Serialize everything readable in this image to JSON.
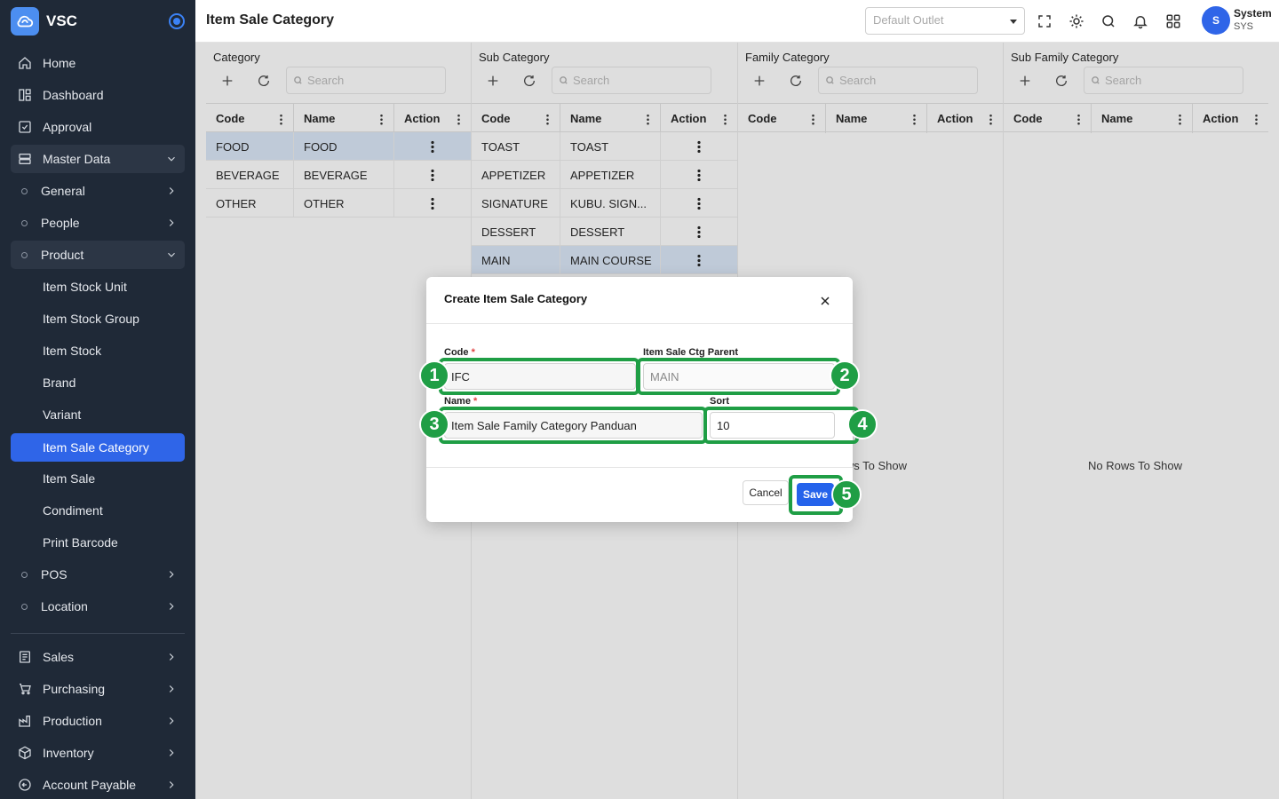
{
  "app": {
    "name": "VSC"
  },
  "sidebar": {
    "items": [
      {
        "label": "Home",
        "icon": "home-icon"
      },
      {
        "label": "Dashboard",
        "icon": "dashboard-icon"
      },
      {
        "label": "Approval",
        "icon": "approval-icon"
      },
      {
        "label": "Master Data",
        "icon": "master-data-icon"
      },
      {
        "label": "General"
      },
      {
        "label": "People"
      },
      {
        "label": "Product"
      },
      {
        "label": "Item Stock Unit"
      },
      {
        "label": "Item Stock Group"
      },
      {
        "label": "Item Stock"
      },
      {
        "label": "Brand"
      },
      {
        "label": "Variant"
      },
      {
        "label": "Item Sale Category"
      },
      {
        "label": "Item Sale"
      },
      {
        "label": "Condiment"
      },
      {
        "label": "Print Barcode"
      },
      {
        "label": "POS"
      },
      {
        "label": "Location"
      },
      {
        "label": "Sales",
        "icon": "sales-icon"
      },
      {
        "label": "Purchasing",
        "icon": "cart-icon"
      },
      {
        "label": "Production",
        "icon": "factory-icon"
      },
      {
        "label": "Inventory",
        "icon": "box-icon"
      },
      {
        "label": "Account Payable",
        "icon": "arrow-circle-icon"
      }
    ]
  },
  "header": {
    "title": "Item Sale Category",
    "outlet_placeholder": "Default Outlet",
    "user": {
      "initial": "S",
      "name": "System",
      "code": "SYS"
    }
  },
  "panels": [
    {
      "title": "Category",
      "search_placeholder": "Search",
      "columns": [
        "Code",
        "Name",
        "Action"
      ],
      "rows": [
        {
          "code": "FOOD",
          "name": "FOOD"
        },
        {
          "code": "BEVERAGE",
          "name": "BEVERAGE"
        },
        {
          "code": "OTHER",
          "name": "OTHER"
        }
      ]
    },
    {
      "title": "Sub Category",
      "search_placeholder": "Search",
      "columns": [
        "Code",
        "Name",
        "Action"
      ],
      "rows": [
        {
          "code": "TOAST",
          "name": "TOAST"
        },
        {
          "code": "APPETIZER",
          "name": "APPETIZER"
        },
        {
          "code": "SIGNATURE",
          "name": "KUBU. SIGN..."
        },
        {
          "code": "DESSERT",
          "name": "DESSERT"
        },
        {
          "code": "MAIN",
          "name": "MAIN COURSE"
        }
      ]
    },
    {
      "title": "Family Category",
      "search_placeholder": "Search",
      "columns": [
        "Code",
        "Name",
        "Action"
      ],
      "empty_text": "No Rows To Show"
    },
    {
      "title": "Sub Family Category",
      "search_placeholder": "Search",
      "columns": [
        "Code",
        "Name",
        "Action"
      ],
      "empty_text": "No Rows To Show"
    }
  ],
  "modal": {
    "title": "Create Item Sale Category",
    "code_label": "Code",
    "code_value": "IFC",
    "parent_label": "Item Sale Ctg Parent",
    "parent_value": "MAIN",
    "name_label": "Name",
    "name_value": "Item Sale Family Category Panduan",
    "sort_label": "Sort",
    "sort_value": "10",
    "cancel_label": "Cancel",
    "save_label": "Save",
    "required_mark": "*"
  },
  "annotations": [
    "1",
    "2",
    "3",
    "4",
    "5"
  ],
  "colors": {
    "sidebar_bg": "#1f2937",
    "accent": "#2f65e8",
    "highlight": "#1f9e45"
  }
}
